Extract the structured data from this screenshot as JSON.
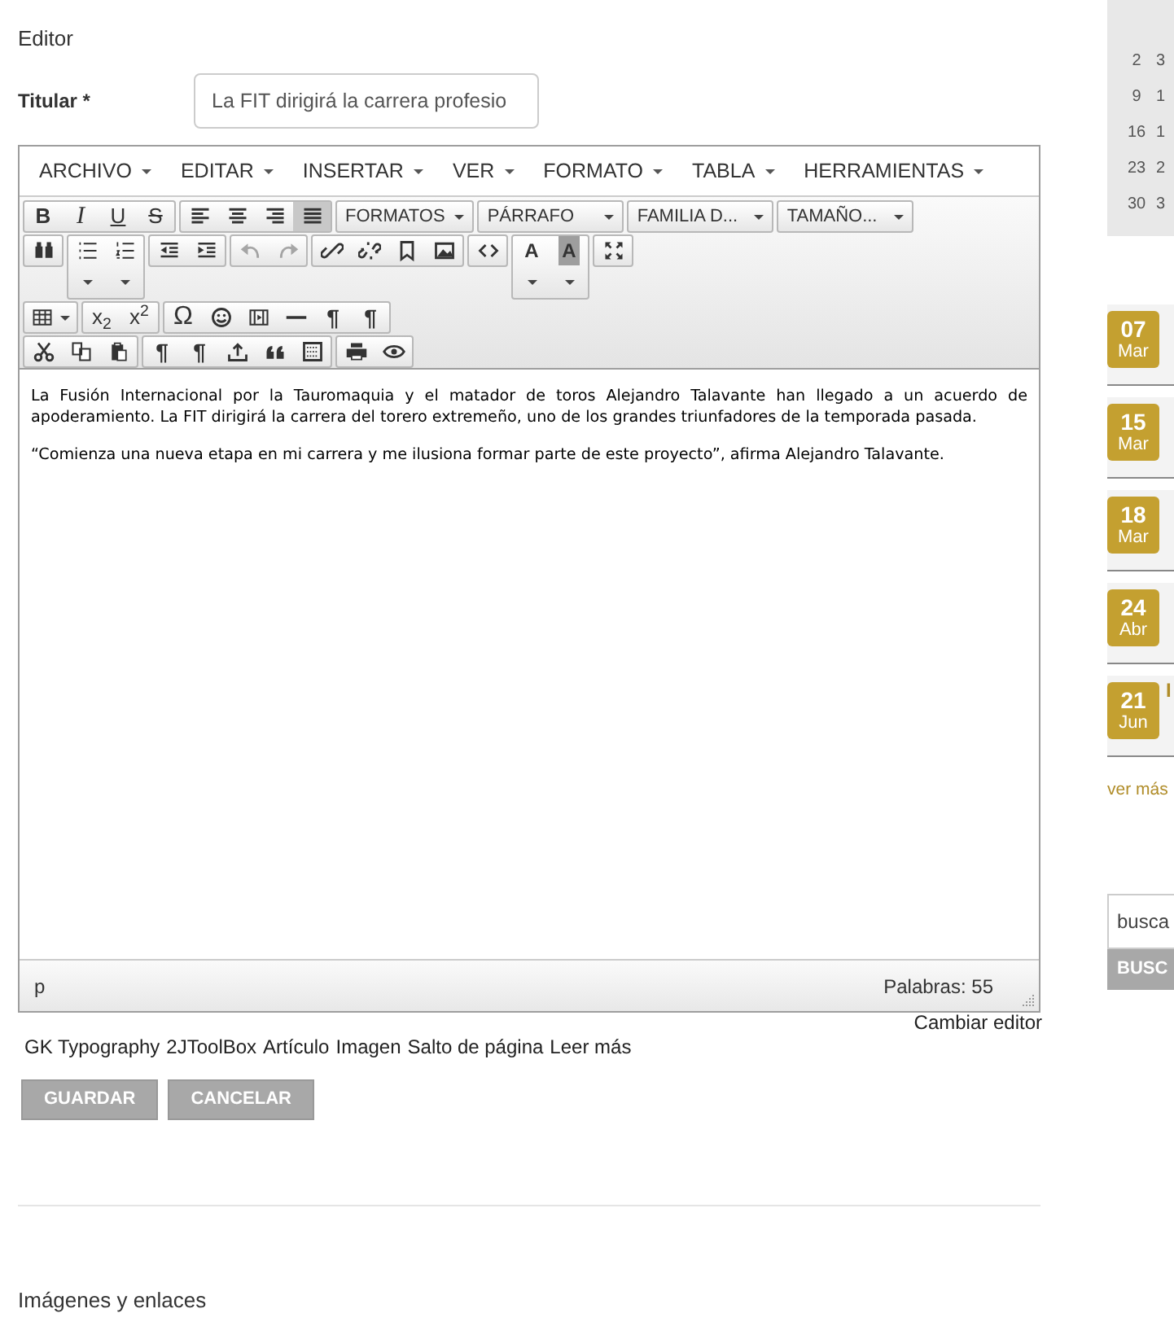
{
  "editor_heading": "Editor",
  "title_field": {
    "label": "Titular *",
    "value": "La FIT dirigirá la carrera profesio"
  },
  "menubar": [
    {
      "label": "ARCHIVO"
    },
    {
      "label": "EDITAR"
    },
    {
      "label": "INSERTAR"
    },
    {
      "label": "VER"
    },
    {
      "label": "FORMATO"
    },
    {
      "label": "TABLA"
    },
    {
      "label": "HERRAMIENTAS"
    }
  ],
  "toolbar": [
    [
      [
        {
          "kind": "bold",
          "label": "B",
          "pressed": false,
          "disabled": false
        },
        {
          "kind": "italic",
          "label": "I",
          "pressed": false,
          "disabled": false
        },
        {
          "kind": "underline",
          "label": "U",
          "pressed": false,
          "disabled": false
        },
        {
          "kind": "strike",
          "label": "S",
          "pressed": false,
          "disabled": false
        }
      ],
      [
        {
          "kind": "alignleft",
          "pressed": false,
          "disabled": false
        },
        {
          "kind": "aligncenter",
          "pressed": false,
          "disabled": false
        },
        {
          "kind": "alignright",
          "pressed": false,
          "disabled": false
        },
        {
          "kind": "justify",
          "pressed": true,
          "disabled": false
        }
      ],
      [
        {
          "kind": "dropdown",
          "label": "FORMATOS"
        }
      ],
      [
        {
          "kind": "dropdown",
          "label": "PÁRRAFO"
        }
      ],
      [
        {
          "kind": "dropdown",
          "label": "FAMILIA D..."
        }
      ],
      [
        {
          "kind": "dropdown",
          "label": "TAMAÑO..."
        }
      ]
    ],
    [
      [
        {
          "kind": "find",
          "pressed": false,
          "disabled": false
        }
      ],
      [
        {
          "kind": "bullist",
          "pressed": false,
          "disabled": false
        },
        {
          "kind": "numlist",
          "pressed": false,
          "disabled": false
        }
      ],
      [
        {
          "kind": "outdent",
          "pressed": false,
          "disabled": false
        },
        {
          "kind": "indent",
          "pressed": false,
          "disabled": false
        }
      ],
      [
        {
          "kind": "undo",
          "pressed": false,
          "disabled": true
        },
        {
          "kind": "redo",
          "pressed": false,
          "disabled": true
        }
      ],
      [
        {
          "kind": "link",
          "pressed": false,
          "disabled": false
        },
        {
          "kind": "unlink",
          "pressed": false,
          "disabled": false
        },
        {
          "kind": "bookmark",
          "pressed": false,
          "disabled": false
        },
        {
          "kind": "image",
          "pressed": false,
          "disabled": false
        }
      ],
      [
        {
          "kind": "code",
          "pressed": false,
          "disabled": false
        }
      ],
      [
        {
          "kind": "forecolor",
          "label": "A",
          "pressed": false,
          "disabled": false
        },
        {
          "kind": "backcolor",
          "label": "A",
          "pressed": false,
          "disabled": false
        }
      ],
      [
        {
          "kind": "fullscreen",
          "pressed": false,
          "disabled": false
        }
      ]
    ],
    [
      [
        {
          "kind": "table",
          "pressed": false,
          "disabled": false
        }
      ],
      [
        {
          "kind": "subscript",
          "label": "x$_{2}$",
          "pressed": false,
          "disabled": false
        },
        {
          "kind": "superscript",
          "label": "x$^{2}$",
          "pressed": false,
          "disabled": false
        }
      ],
      [
        {
          "kind": "charmap",
          "label": "Ω",
          "pressed": false,
          "disabled": false
        },
        {
          "kind": "emoticons",
          "pressed": false,
          "disabled": false
        },
        {
          "kind": "media",
          "pressed": false,
          "disabled": false
        },
        {
          "kind": "hr",
          "pressed": false,
          "disabled": false
        },
        {
          "kind": "ltr",
          "label": "¶",
          "pressed": false,
          "disabled": false
        },
        {
          "kind": "rtl",
          "label": "¶",
          "pressed": false,
          "disabled": false
        }
      ]
    ],
    [
      [
        {
          "kind": "cut",
          "pressed": false,
          "disabled": false
        },
        {
          "kind": "copy",
          "pressed": false,
          "disabled": false
        },
        {
          "kind": "paste",
          "pressed": false,
          "disabled": false
        }
      ],
      [
        {
          "kind": "visualchars",
          "label": "¶",
          "pressed": false,
          "disabled": false
        },
        {
          "kind": "nonbreaking",
          "label": "¶",
          "pressed": false,
          "disabled": false
        },
        {
          "kind": "insert",
          "pressed": false,
          "disabled": false
        },
        {
          "kind": "blockquote",
          "pressed": false,
          "disabled": false
        },
        {
          "kind": "template",
          "pressed": false,
          "disabled": false
        }
      ],
      [
        {
          "kind": "print",
          "pressed": false,
          "disabled": false
        },
        {
          "kind": "preview",
          "pressed": false,
          "disabled": false
        }
      ]
    ]
  ],
  "content": [
    "La Fusión Internacional por la Tauromaquia y el matador de toros Alejandro Talavante han llegado a un acuerdo de apoderamiento. La FIT dirigirá la carrera del torero extremeño, uno de los grandes triunfadores de la temporada pasada.",
    "“Comienza una nueva etapa en mi carrera y me ilusiona formar parte de este proyecto”, afirma Alejandro Talavante."
  ],
  "status_bar": {
    "path": "p",
    "word_count": "Palabras: 55"
  },
  "toggle_editor": "Cambiar editor",
  "editor_buttons": [
    "GK Typography",
    "2JToolBox",
    "Artículo",
    "Imagen",
    "Salto de página",
    "Leer más"
  ],
  "actions": [
    "GUARDAR",
    "CANCELAR"
  ],
  "next_section": "Imágenes y enlaces",
  "calendar": {
    "rows": [
      [
        "2",
        "3"
      ],
      [
        "9",
        "1"
      ],
      [
        "16",
        "1"
      ],
      [
        "23",
        "2"
      ],
      [
        "30",
        "3"
      ]
    ]
  },
  "events": [
    {
      "day": "07",
      "month": "Mar"
    },
    {
      "day": "15",
      "month": "Mar"
    },
    {
      "day": "18",
      "month": "Mar"
    },
    {
      "day": "24",
      "month": "Abr"
    },
    {
      "day": "21",
      "month": "Jun",
      "title": "I"
    }
  ],
  "more_link": "ver más",
  "search": {
    "value": "busca",
    "button": "BUSC"
  }
}
